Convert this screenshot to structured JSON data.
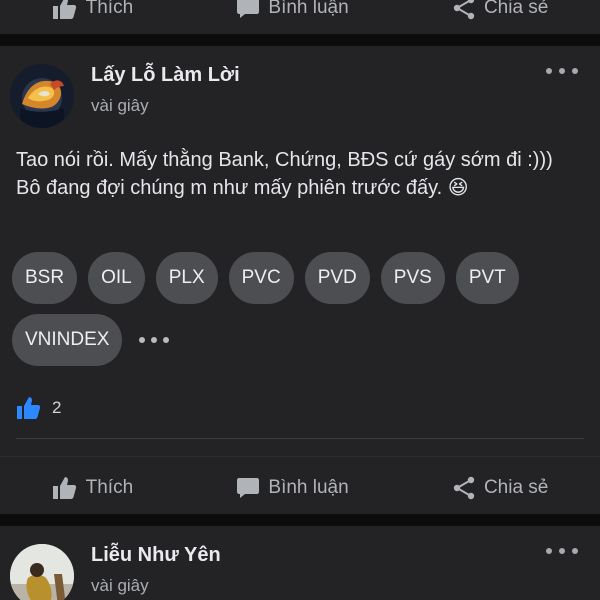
{
  "actions": {
    "like": "Thích",
    "comment": "Bình luận",
    "share": "Chia sẻ"
  },
  "post": {
    "author": "Lấy Lỗ Làm Lời",
    "time": "vài giây",
    "content_line1": "Tao nói rồi. Mấy thằng Bank, Chứng, BĐS cứ gáy sớm đi :)))",
    "content_line2": "Bô đang đợi chúng m như mấy phiên trước đấy. 😆",
    "tags": [
      "BSR",
      "OIL",
      "PLX",
      "PVC",
      "PVD",
      "PVS",
      "PVT",
      "VNINDEX"
    ],
    "like_count": "2"
  },
  "post2": {
    "author": "Liễu Như Yên",
    "time": "vài giây"
  },
  "colors": {
    "background": "#0f0f10",
    "card": "#232325",
    "tag": "#4d4e52",
    "like_blue": "#2d88ff"
  }
}
